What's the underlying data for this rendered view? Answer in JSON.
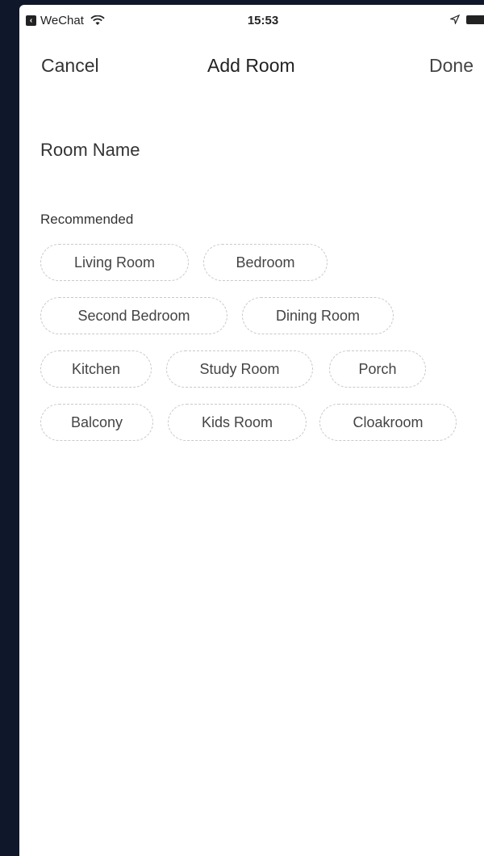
{
  "status_bar": {
    "app_name": "WeChat",
    "time": "15:53",
    "icons": [
      "back-app-icon",
      "wifi-icon",
      "location-icon",
      "battery-icon"
    ]
  },
  "nav": {
    "cancel_label": "Cancel",
    "title": "Add Room",
    "done_label": "Done"
  },
  "room_name": {
    "placeholder": "Room Name",
    "value": ""
  },
  "recommended": {
    "label": "Recommended",
    "chips": [
      "Living Room",
      "Bedroom",
      "Second Bedroom",
      "Dining Room",
      "Kitchen",
      "Study Room",
      "Porch",
      "Balcony",
      "Kids Room",
      "Cloakroom"
    ]
  },
  "colors": {
    "outer_background": "#0f172b",
    "screen_background": "#ffffff",
    "chip_border": "#c9c9c9",
    "text": "#333333"
  }
}
